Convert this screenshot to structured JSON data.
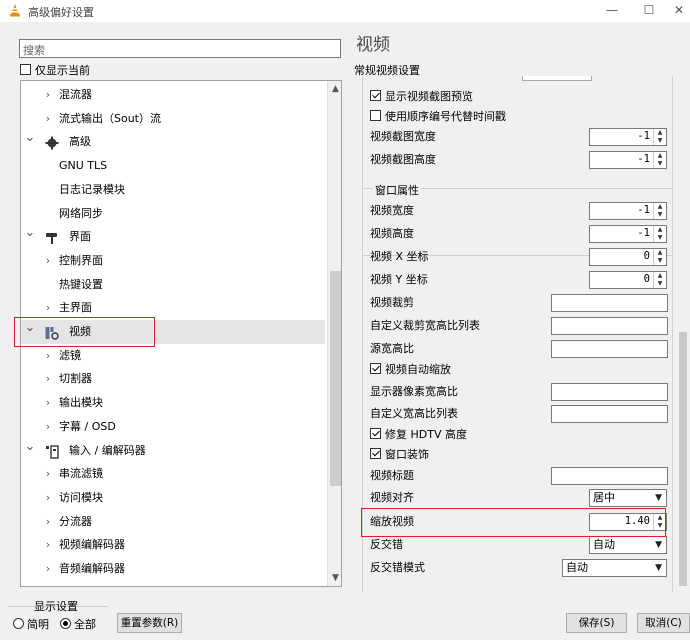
{
  "window": {
    "title": "高级偏好设置",
    "minimize": "—",
    "maximize": "☐",
    "close": "✕"
  },
  "left": {
    "search_placeholder": "搜索",
    "only_current_label": "仅显示当前",
    "tree": [
      {
        "label": "混流器",
        "chevron": "›",
        "level": 1
      },
      {
        "label": "流式输出（Sout）流",
        "chevron": "›",
        "level": 1
      },
      {
        "label": "高级",
        "chevron": "⌄",
        "level": 0,
        "icon": "gear-icon"
      },
      {
        "label": "GNU TLS",
        "chevron": "",
        "level": 1
      },
      {
        "label": "日志记录模块",
        "chevron": "",
        "level": 1
      },
      {
        "label": "网络同步",
        "chevron": "",
        "level": 1
      },
      {
        "label": "界面",
        "chevron": "⌄",
        "level": 0,
        "icon": "paint-roller-icon"
      },
      {
        "label": "控制界面",
        "chevron": "›",
        "level": 1
      },
      {
        "label": "热键设置",
        "chevron": "",
        "level": 1
      },
      {
        "label": "主界面",
        "chevron": "›",
        "level": 1
      },
      {
        "label": "视频",
        "chevron": "⌄",
        "level": 0,
        "icon": "video-settings-icon",
        "selected": true
      },
      {
        "label": "滤镜",
        "chevron": "›",
        "level": 1
      },
      {
        "label": "切割器",
        "chevron": "›",
        "level": 1
      },
      {
        "label": "输出模块",
        "chevron": "›",
        "level": 1
      },
      {
        "label": "字幕 / OSD",
        "chevron": "›",
        "level": 1
      },
      {
        "label": "输入 / 编解码器",
        "chevron": "⌄",
        "level": 0,
        "icon": "codec-icon"
      },
      {
        "label": "串流滤镜",
        "chevron": "›",
        "level": 1
      },
      {
        "label": "访问模块",
        "chevron": "›",
        "level": 1
      },
      {
        "label": "分流器",
        "chevron": "›",
        "level": 1
      },
      {
        "label": "视频编解码器",
        "chevron": "›",
        "level": 1
      },
      {
        "label": "音频编解码器",
        "chevron": "›",
        "level": 1
      }
    ],
    "display_group_title": "显示设置",
    "radio_simple": "简明",
    "radio_all": "全部",
    "reset_button": "重置参数(R)"
  },
  "right": {
    "title": "视频",
    "subtitle": "常规视频设置",
    "top_rows": [
      {
        "type": "checkbox",
        "label": "显示视频截图预览",
        "checked": true
      },
      {
        "type": "checkbox",
        "label": "使用顺序编号代替时间戳",
        "checked": false
      },
      {
        "type": "spin",
        "label": "视频截图宽度",
        "value": "-1"
      },
      {
        "type": "spin",
        "label": "视频截图高度",
        "value": "-1"
      }
    ],
    "window_group_title": "窗口属性",
    "window_rows": [
      {
        "type": "spin",
        "label": "视频宽度",
        "value": "-1"
      },
      {
        "type": "spin",
        "label": "视频高度",
        "value": "-1"
      },
      {
        "type": "spin",
        "label": "视频 X 坐标",
        "value": "0"
      },
      {
        "type": "spin",
        "label": "视频 Y 坐标",
        "value": "0"
      },
      {
        "type": "text",
        "label": "视频裁剪",
        "value": ""
      },
      {
        "type": "text",
        "label": "自定义裁剪宽高比列表",
        "value": ""
      },
      {
        "type": "text",
        "label": "源宽高比",
        "value": ""
      },
      {
        "type": "checkbox",
        "label": "视频自动缩放",
        "checked": true
      },
      {
        "type": "text",
        "label": "显示器像素宽高比",
        "value": ""
      },
      {
        "type": "text",
        "label": "自定义宽高比列表",
        "value": ""
      },
      {
        "type": "checkbox",
        "label": "修复 HDTV 高度",
        "checked": true
      },
      {
        "type": "checkbox",
        "label": "窗口装饰",
        "checked": true
      },
      {
        "type": "text",
        "label": "视频标题",
        "value": ""
      },
      {
        "type": "select",
        "label": "视频对齐",
        "value": "居中"
      },
      {
        "type": "spin",
        "label": "缩放视频",
        "value": "1.40",
        "highlighted": true
      },
      {
        "type": "select",
        "label": "反交错",
        "value": "自动"
      },
      {
        "type": "select",
        "label": "反交错模式",
        "value": "自动",
        "wide": true
      }
    ],
    "save_button": "保存(S)",
    "cancel_button": "取消(C)"
  },
  "colors": {
    "highlight": "#e02020",
    "selection": "#e5e5e5",
    "background": "#f0f0f0"
  }
}
